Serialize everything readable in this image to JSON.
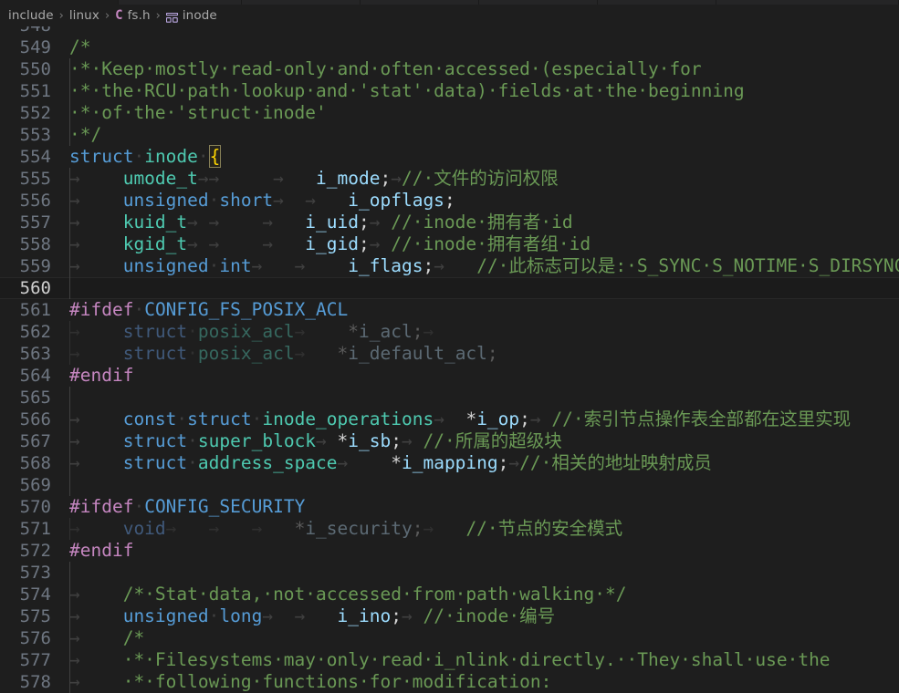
{
  "window": {
    "background": "#1e1e1e",
    "tab_strip_segments": [
      130,
      135,
      130,
      130,
      130,
      130,
      200
    ]
  },
  "breadcrumb": {
    "name": "breadcrumb-bar",
    "separator": "›",
    "items": [
      {
        "label": "include",
        "icon": ""
      },
      {
        "label": "linux",
        "icon": ""
      },
      {
        "label": "fs.h",
        "icon": "c-file-icon"
      },
      {
        "label": "inode",
        "icon": "struct-symbol-icon"
      }
    ]
  },
  "editor": {
    "name": "code-editor",
    "language": "c",
    "active_line": 560,
    "line_height": 24,
    "first_partial_line": "548",
    "colors": {
      "background": "#1e1e1e",
      "comment": "#6A9955",
      "keyword": "#569CD6",
      "type": "#4EC9B0",
      "variable": "#9CDCFE",
      "preprocessor": "#C586C0",
      "bracket_match": "#FFD700",
      "line_number": "#6e7681",
      "active_line_number": "#cfcfcf",
      "whitespace_guide": "#404040",
      "dimmed_text": "#5a5a5a"
    },
    "lines": [
      {
        "n": "549",
        "indent": 0,
        "guide": false,
        "dim": false,
        "tokens": [
          {
            "t": "/*",
            "c": "cmt"
          }
        ]
      },
      {
        "n": "550",
        "indent": 0,
        "guide": true,
        "dim": false,
        "tokens": [
          {
            "t": "·*·Keep·mostly·read-only·and·often·accessed·(especially·for",
            "c": "cmt"
          }
        ]
      },
      {
        "n": "551",
        "indent": 0,
        "guide": true,
        "dim": false,
        "tokens": [
          {
            "t": "·*·the·RCU·path·lookup·and·'stat'·data)·fields·at·the·beginning",
            "c": "cmt"
          }
        ]
      },
      {
        "n": "552",
        "indent": 0,
        "guide": true,
        "dim": false,
        "tokens": [
          {
            "t": "·*·of·the·'struct·inode'",
            "c": "cmt"
          }
        ]
      },
      {
        "n": "553",
        "indent": 0,
        "guide": true,
        "dim": false,
        "tokens": [
          {
            "t": "·*/",
            "c": "cmt"
          }
        ]
      },
      {
        "n": "554",
        "indent": 0,
        "guide": false,
        "dim": false,
        "tokens": [
          {
            "t": "struct",
            "c": "kw"
          },
          {
            "t": "·",
            "c": "ws"
          },
          {
            "t": "inode",
            "c": "typ"
          },
          {
            "t": "·",
            "c": "ws"
          },
          {
            "t": "{",
            "c": "bmatch"
          }
        ]
      },
      {
        "n": "555",
        "indent": 0,
        "guide": true,
        "dim": false,
        "tokens": [
          {
            "t": "→    ",
            "c": "ws"
          },
          {
            "t": "umode_t",
            "c": "typ"
          },
          {
            "t": "→→     →   ",
            "c": "ws"
          },
          {
            "t": "i_mode",
            "c": "var"
          },
          {
            "t": ";",
            "c": "pun"
          },
          {
            "t": "→",
            "c": "ws"
          },
          {
            "t": "//·文件的访问权限",
            "c": "cmt"
          }
        ]
      },
      {
        "n": "556",
        "indent": 0,
        "guide": true,
        "dim": false,
        "tokens": [
          {
            "t": "→    ",
            "c": "ws"
          },
          {
            "t": "unsigned",
            "c": "kw"
          },
          {
            "t": "·",
            "c": "ws"
          },
          {
            "t": "short",
            "c": "kw"
          },
          {
            "t": "→  →   ",
            "c": "ws"
          },
          {
            "t": "i_opflags",
            "c": "var"
          },
          {
            "t": ";",
            "c": "pun"
          }
        ]
      },
      {
        "n": "557",
        "indent": 0,
        "guide": true,
        "dim": false,
        "tokens": [
          {
            "t": "→    ",
            "c": "ws"
          },
          {
            "t": "kuid_t",
            "c": "typ"
          },
          {
            "t": "→ →    →   ",
            "c": "ws"
          },
          {
            "t": "i_uid",
            "c": "var"
          },
          {
            "t": ";",
            "c": "pun"
          },
          {
            "t": "→ ",
            "c": "ws"
          },
          {
            "t": "//·inode·拥有者·id",
            "c": "cmt"
          }
        ]
      },
      {
        "n": "558",
        "indent": 0,
        "guide": true,
        "dim": false,
        "tokens": [
          {
            "t": "→    ",
            "c": "ws"
          },
          {
            "t": "kgid_t",
            "c": "typ"
          },
          {
            "t": "→ →    →   ",
            "c": "ws"
          },
          {
            "t": "i_gid",
            "c": "var"
          },
          {
            "t": ";",
            "c": "pun"
          },
          {
            "t": "→ ",
            "c": "ws"
          },
          {
            "t": "//·inode·拥有者组·id",
            "c": "cmt"
          }
        ]
      },
      {
        "n": "559",
        "indent": 0,
        "guide": true,
        "dim": false,
        "tokens": [
          {
            "t": "→    ",
            "c": "ws"
          },
          {
            "t": "unsigned",
            "c": "kw"
          },
          {
            "t": "·",
            "c": "ws"
          },
          {
            "t": "int",
            "c": "kw"
          },
          {
            "t": "→   →    ",
            "c": "ws"
          },
          {
            "t": "i_flags",
            "c": "var"
          },
          {
            "t": ";",
            "c": "pun"
          },
          {
            "t": "→   ",
            "c": "ws"
          },
          {
            "t": "//·此标志可以是:·S_SYNC·S_NOTIME·S_DIRSYNC·等",
            "c": "cmt"
          }
        ]
      },
      {
        "n": "560",
        "indent": 0,
        "guide": true,
        "dim": false,
        "active": true,
        "tokens": []
      },
      {
        "n": "561",
        "indent": 0,
        "guide": false,
        "dim": false,
        "tokens": [
          {
            "t": "#ifdef",
            "c": "pp"
          },
          {
            "t": "·",
            "c": "ws"
          },
          {
            "t": "CONFIG_FS_POSIX_ACL",
            "c": "ppid"
          }
        ]
      },
      {
        "n": "562",
        "indent": 0,
        "guide": true,
        "dim": true,
        "tokens": [
          {
            "t": "→    ",
            "c": "ws"
          },
          {
            "t": "struct",
            "c": "kw"
          },
          {
            "t": "·",
            "c": "ws"
          },
          {
            "t": "posix_acl",
            "c": "typ"
          },
          {
            "t": "→    ",
            "c": "ws"
          },
          {
            "t": "*",
            "c": "pun"
          },
          {
            "t": "i_acl",
            "c": "var"
          },
          {
            "t": ";",
            "c": "pun"
          },
          {
            "t": "→",
            "c": "ws"
          }
        ]
      },
      {
        "n": "563",
        "indent": 0,
        "guide": true,
        "dim": true,
        "tokens": [
          {
            "t": "→    ",
            "c": "ws"
          },
          {
            "t": "struct",
            "c": "kw"
          },
          {
            "t": "·",
            "c": "ws"
          },
          {
            "t": "posix_acl",
            "c": "typ"
          },
          {
            "t": "→   ",
            "c": "ws"
          },
          {
            "t": "*",
            "c": "pun"
          },
          {
            "t": "i_default_acl",
            "c": "var"
          },
          {
            "t": ";",
            "c": "pun"
          }
        ]
      },
      {
        "n": "564",
        "indent": 0,
        "guide": false,
        "dim": false,
        "tokens": [
          {
            "t": "#endif",
            "c": "pp"
          }
        ]
      },
      {
        "n": "565",
        "indent": 0,
        "guide": true,
        "dim": false,
        "tokens": []
      },
      {
        "n": "566",
        "indent": 0,
        "guide": true,
        "dim": false,
        "tokens": [
          {
            "t": "→    ",
            "c": "ws"
          },
          {
            "t": "const",
            "c": "kw"
          },
          {
            "t": "·",
            "c": "ws"
          },
          {
            "t": "struct",
            "c": "kw"
          },
          {
            "t": "·",
            "c": "ws"
          },
          {
            "t": "inode_operations",
            "c": "typ"
          },
          {
            "t": "→  ",
            "c": "ws"
          },
          {
            "t": "*",
            "c": "pun"
          },
          {
            "t": "i_op",
            "c": "var"
          },
          {
            "t": ";",
            "c": "pun"
          },
          {
            "t": "→ ",
            "c": "ws"
          },
          {
            "t": "//·索引节点操作表全部都在这里实现",
            "c": "cmt"
          }
        ]
      },
      {
        "n": "567",
        "indent": 0,
        "guide": true,
        "dim": false,
        "tokens": [
          {
            "t": "→    ",
            "c": "ws"
          },
          {
            "t": "struct",
            "c": "kw"
          },
          {
            "t": "·",
            "c": "ws"
          },
          {
            "t": "super_block",
            "c": "typ"
          },
          {
            "t": "→ ",
            "c": "ws"
          },
          {
            "t": "*",
            "c": "pun"
          },
          {
            "t": "i_sb",
            "c": "var"
          },
          {
            "t": ";",
            "c": "pun"
          },
          {
            "t": "→ ",
            "c": "ws"
          },
          {
            "t": "//·所属的超级块",
            "c": "cmt"
          }
        ]
      },
      {
        "n": "568",
        "indent": 0,
        "guide": true,
        "dim": false,
        "tokens": [
          {
            "t": "→    ",
            "c": "ws"
          },
          {
            "t": "struct",
            "c": "kw"
          },
          {
            "t": "·",
            "c": "ws"
          },
          {
            "t": "address_space",
            "c": "typ"
          },
          {
            "t": "→    ",
            "c": "ws"
          },
          {
            "t": "*",
            "c": "pun"
          },
          {
            "t": "i_mapping",
            "c": "var"
          },
          {
            "t": ";",
            "c": "pun"
          },
          {
            "t": "→",
            "c": "ws"
          },
          {
            "t": "//·相关的地址映射成员",
            "c": "cmt"
          }
        ]
      },
      {
        "n": "569",
        "indent": 0,
        "guide": true,
        "dim": false,
        "tokens": []
      },
      {
        "n": "570",
        "indent": 0,
        "guide": false,
        "dim": false,
        "tokens": [
          {
            "t": "#ifdef",
            "c": "pp"
          },
          {
            "t": "·",
            "c": "ws"
          },
          {
            "t": "CONFIG_SECURITY",
            "c": "ppid"
          }
        ]
      },
      {
        "n": "571",
        "indent": 0,
        "guide": true,
        "dim": true,
        "tokens": [
          {
            "t": "→    ",
            "c": "ws"
          },
          {
            "t": "void",
            "c": "kw"
          },
          {
            "t": "→   →   →   ",
            "c": "ws"
          },
          {
            "t": "*",
            "c": "pun"
          },
          {
            "t": "i_security",
            "c": "var"
          },
          {
            "t": ";",
            "c": "pun"
          },
          {
            "t": "→   ",
            "c": "ws"
          },
          {
            "t": "//·节点的安全模式",
            "c": "cmt"
          }
        ]
      },
      {
        "n": "572",
        "indent": 0,
        "guide": false,
        "dim": false,
        "tokens": [
          {
            "t": "#endif",
            "c": "pp"
          }
        ]
      },
      {
        "n": "573",
        "indent": 0,
        "guide": true,
        "dim": false,
        "tokens": []
      },
      {
        "n": "574",
        "indent": 0,
        "guide": true,
        "dim": false,
        "tokens": [
          {
            "t": "→    ",
            "c": "ws"
          },
          {
            "t": "/*·Stat·data,·not·accessed·from·path·walking·*/",
            "c": "cmt"
          }
        ]
      },
      {
        "n": "575",
        "indent": 0,
        "guide": true,
        "dim": false,
        "tokens": [
          {
            "t": "→    ",
            "c": "ws"
          },
          {
            "t": "unsigned",
            "c": "kw"
          },
          {
            "t": "·",
            "c": "ws"
          },
          {
            "t": "long",
            "c": "kw"
          },
          {
            "t": "→  →   ",
            "c": "ws"
          },
          {
            "t": "i_ino",
            "c": "var"
          },
          {
            "t": ";",
            "c": "pun"
          },
          {
            "t": "→ ",
            "c": "ws"
          },
          {
            "t": "//·inode·编号",
            "c": "cmt"
          }
        ]
      },
      {
        "n": "576",
        "indent": 0,
        "guide": true,
        "dim": false,
        "tokens": [
          {
            "t": "→    ",
            "c": "ws"
          },
          {
            "t": "/*",
            "c": "cmt"
          }
        ]
      },
      {
        "n": "577",
        "indent": 0,
        "guide": true,
        "dim": false,
        "tokens": [
          {
            "t": "→    ",
            "c": "ws"
          },
          {
            "t": "·*·Filesystems·may·only·read·i_nlink·directly.··They·shall·use·the",
            "c": "cmt"
          }
        ]
      },
      {
        "n": "578",
        "indent": 0,
        "guide": true,
        "dim": false,
        "tokens": [
          {
            "t": "→    ",
            "c": "ws"
          },
          {
            "t": "·*·following·functions·for·modification:",
            "c": "cmt"
          }
        ]
      }
    ]
  }
}
